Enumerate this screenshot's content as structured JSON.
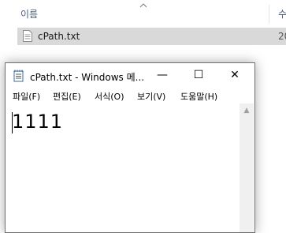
{
  "explorer": {
    "column_name": "이름",
    "column_next": "수",
    "file": {
      "name": "cPath.txt",
      "next_col": "20",
      "icon": "text-file-icon"
    }
  },
  "notepad": {
    "title": "cPath.txt - Windows 메...",
    "controls": {
      "minimize": "—",
      "maximize": "☐",
      "close": "✕"
    },
    "menu": [
      {
        "label": "파일(F)"
      },
      {
        "label": "편집(E)"
      },
      {
        "label": "서식(O)"
      },
      {
        "label": "보기(V)"
      },
      {
        "label": "도움말(H)"
      }
    ],
    "content": "1111",
    "scroll_up": "▲"
  }
}
